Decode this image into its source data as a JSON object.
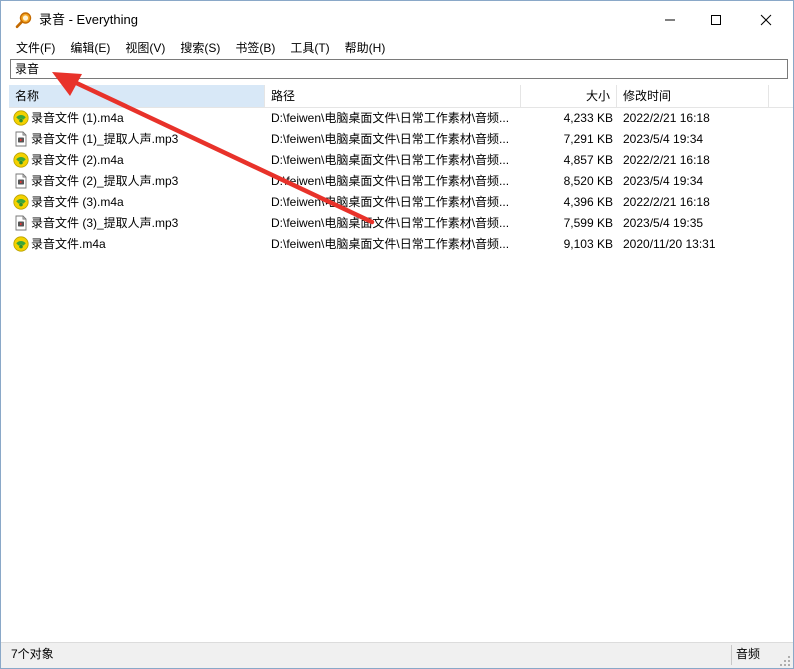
{
  "window": {
    "title": "录音 - Everything"
  },
  "menu": [
    "文件(F)",
    "编辑(E)",
    "视图(V)",
    "搜索(S)",
    "书签(B)",
    "工具(T)",
    "帮助(H)"
  ],
  "search": {
    "value": "录音"
  },
  "columns": {
    "name": "名称",
    "path": "路径",
    "size": "大小",
    "date": "修改时间"
  },
  "files": [
    {
      "name": "录音文件 (1).m4a",
      "path": "D:\\feiwen\\电脑桌面文件\\日常工作素材\\音频...",
      "size": "4,233 KB",
      "date": "2022/2/21 16:18",
      "icon": "m4a-audio-icon"
    },
    {
      "name": "录音文件 (1)_提取人声.mp3",
      "path": "D:\\feiwen\\电脑桌面文件\\日常工作素材\\音频...",
      "size": "7,291 KB",
      "date": "2023/5/4 19:34",
      "icon": "mp3-audio-icon"
    },
    {
      "name": "录音文件 (2).m4a",
      "path": "D:\\feiwen\\电脑桌面文件\\日常工作素材\\音频...",
      "size": "4,857 KB",
      "date": "2022/2/21 16:18",
      "icon": "m4a-audio-icon"
    },
    {
      "name": "录音文件 (2)_提取人声.mp3",
      "path": "D:\\feiwen\\电脑桌面文件\\日常工作素材\\音频...",
      "size": "8,520 KB",
      "date": "2023/5/4 19:34",
      "icon": "mp3-audio-icon"
    },
    {
      "name": "录音文件 (3).m4a",
      "path": "D:\\feiwen\\电脑桌面文件\\日常工作素材\\音频...",
      "size": "4,396 KB",
      "date": "2022/2/21 16:18",
      "icon": "m4a-audio-icon"
    },
    {
      "name": "录音文件 (3)_提取人声.mp3",
      "path": "D:\\feiwen\\电脑桌面文件\\日常工作素材\\音频...",
      "size": "7,599 KB",
      "date": "2023/5/4 19:35",
      "icon": "mp3-audio-icon"
    },
    {
      "name": "录音文件.m4a",
      "path": "D:\\feiwen\\电脑桌面文件\\日常工作素材\\音频...",
      "size": "9,103 KB",
      "date": "2020/11/20 13:31",
      "icon": "m4a-audio-icon"
    }
  ],
  "status": {
    "count": "7个对象",
    "filter": "音频"
  },
  "colors": {
    "header_selected": "#d8e8f7",
    "annotation_arrow": "#e8322a"
  }
}
